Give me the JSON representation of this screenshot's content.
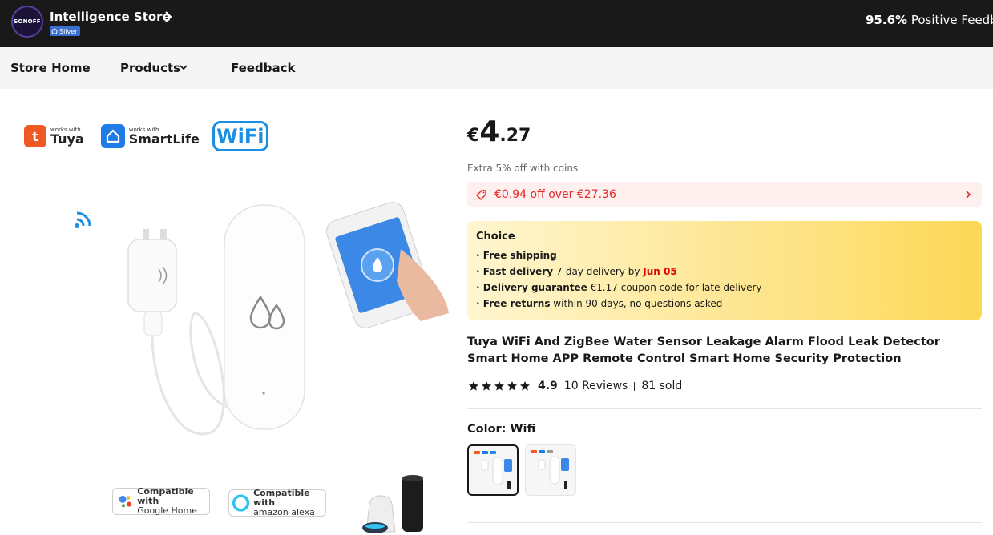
{
  "store": {
    "logo_text": "SONOFF",
    "name": "Intelligence Store",
    "badge": "Silver",
    "feedback_percent": "95.6%",
    "feedback_label": "Positive Feedback"
  },
  "nav": {
    "home": "Store Home",
    "products": "Products",
    "feedback": "Feedback"
  },
  "gallery": {
    "tuya_small": "works with",
    "tuya_big": "Tuya",
    "tuya_icon": "t",
    "smartlife_small": "works with",
    "smartlife_big": "SmartLife",
    "wifi": "WiFi",
    "google_top": "Compatible with",
    "google_bottom": "Google Home",
    "alexa_top": "Compatible with",
    "alexa_bottom": "amazon alexa"
  },
  "price": {
    "currency": "€",
    "integer": "4",
    "decimal": ".27",
    "coins_note": "Extra 5% off with coins"
  },
  "coupon": {
    "text": "€0.94 off over €27.36"
  },
  "choice": {
    "title": "Choice",
    "line1_bold": "· Free shipping",
    "line2_bold": "· Fast delivery",
    "line2_text": " 7-day delivery by ",
    "line2_date": "Jun 05",
    "line3_bold": "· Delivery guarantee",
    "line3_text": "  €1.17 coupon code for late delivery",
    "line4_bold": "· Free returns",
    "line4_text": "  within 90 days, no questions asked"
  },
  "product": {
    "title": "Tuya WiFi And ZigBee Water Sensor Leakage Alarm Flood Leak Detector Smart Home APP Remote Control Smart Home Security Protection",
    "rating": 4.9,
    "rating_text": "4.9",
    "reviews": "10 Reviews",
    "sold": "81 sold",
    "color_label": "Color: ",
    "color_value": "Wifi"
  },
  "colors": {
    "accent_red": "#e22a2a",
    "topbar_bg": "#191919",
    "badge_blue": "#3a6fd1",
    "choice_yellow": "#fdd855"
  }
}
